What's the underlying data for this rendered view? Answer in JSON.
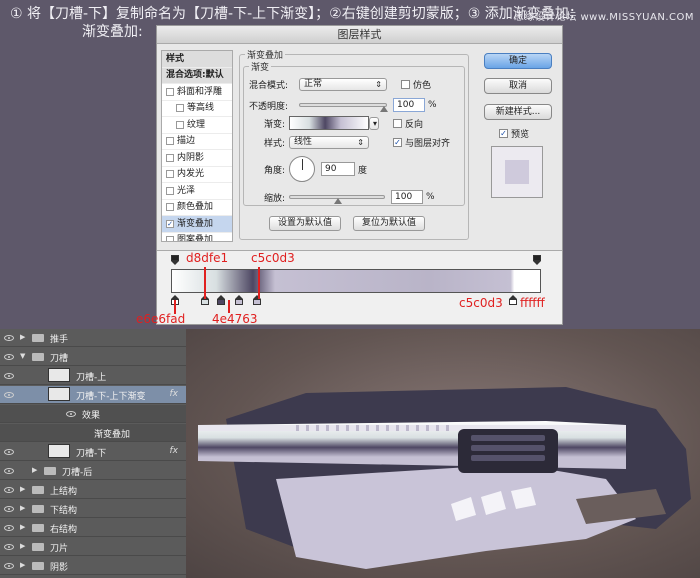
{
  "header": {
    "line1": "① 将【刀槽-下】复制命名为【刀槽-下-上下渐变】；②右键创建剪切蒙版；③ 添加渐变叠加",
    "line1_tail": "：",
    "line2": "渐变叠加:",
    "watermark": "思缘设计论坛 www.MISSYUAN.COM"
  },
  "dialog": {
    "title": "图层样式",
    "styles_header": "样式",
    "blend_default": "混合选项:默认",
    "style_items": [
      {
        "label": "斜面和浮雕",
        "checked": false,
        "indent": false
      },
      {
        "label": "等高线",
        "checked": false,
        "indent": true
      },
      {
        "label": "纹理",
        "checked": false,
        "indent": true
      },
      {
        "label": "描边",
        "checked": false,
        "indent": false
      },
      {
        "label": "内阴影",
        "checked": false,
        "indent": false
      },
      {
        "label": "内发光",
        "checked": false,
        "indent": false
      },
      {
        "label": "光泽",
        "checked": false,
        "indent": false
      },
      {
        "label": "颜色叠加",
        "checked": false,
        "indent": false
      },
      {
        "label": "渐变叠加",
        "checked": true,
        "indent": false
      },
      {
        "label": "图案叠加",
        "checked": false,
        "indent": false
      }
    ],
    "group_outer": "渐变叠加",
    "group_inner": "渐变",
    "blend_mode_label": "混合模式:",
    "blend_mode_value": "正常",
    "dither_label": "仿色",
    "opacity_label": "不透明度:",
    "opacity_value": "100",
    "percent": "%",
    "gradient_label": "渐变:",
    "reverse_label": "反向",
    "style_label": "样式:",
    "style_value": "线性",
    "align_label": "与图层对齐",
    "angle_label": "角度:",
    "angle_value": "90",
    "degree": "度",
    "scale_label": "缩放:",
    "scale_value": "100",
    "set_default": "设置为默认值",
    "reset_default": "复位为默认值",
    "ok": "确定",
    "cancel": "取消",
    "new_style": "新建样式...",
    "preview": "预览"
  },
  "gradient_annotations": {
    "d8dfe1": "d8dfe1",
    "c5c0d3_top": "c5c0d3",
    "e6e6fad": "e6e6fad",
    "4e4763": "4e4763",
    "c5c0d3_right": "c5c0d3",
    "ffffff": "ffffff"
  },
  "layers": [
    {
      "name": "推手",
      "type": "folder",
      "collapsed": true,
      "indent": 0
    },
    {
      "name": "刀槽",
      "type": "folder",
      "collapsed": false,
      "indent": 0
    },
    {
      "name": "刀槽-上",
      "type": "layer",
      "indent": 1
    },
    {
      "name": "刀槽-下-上下渐变",
      "type": "layer",
      "indent": 1,
      "selected": true,
      "fx": "fx"
    },
    {
      "name": "效果",
      "type": "effect",
      "indent": 2
    },
    {
      "name": "渐变叠加",
      "type": "effect",
      "indent": 3
    },
    {
      "name": "刀槽-下",
      "type": "layer",
      "indent": 1,
      "fx": "fx"
    },
    {
      "name": "刀槽-后",
      "type": "folder",
      "collapsed": true,
      "indent": 1
    },
    {
      "name": "上结构",
      "type": "folder",
      "collapsed": true,
      "indent": 0
    },
    {
      "name": "下结构",
      "type": "folder",
      "collapsed": true,
      "indent": 0
    },
    {
      "name": "右结构",
      "type": "folder",
      "collapsed": true,
      "indent": 0
    },
    {
      "name": "刀片",
      "type": "folder",
      "collapsed": true,
      "indent": 0
    },
    {
      "name": "阴影",
      "type": "folder",
      "collapsed": true,
      "indent": 0
    }
  ],
  "colors": {
    "grad_c1": "#ffffff",
    "grad_c2": "#d8dfe1",
    "grad_c3": "#4e4763",
    "grad_c4": "#c5c0d3",
    "annotation": "#e02020"
  }
}
